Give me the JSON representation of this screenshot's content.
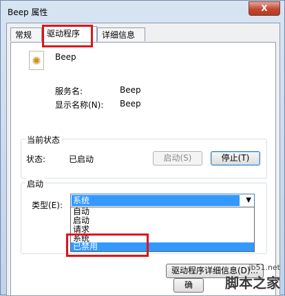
{
  "window": {
    "title": "Beep 属性",
    "close_label": "X"
  },
  "tabs": [
    {
      "label": "常规"
    },
    {
      "label": "驱动程序"
    },
    {
      "label": "详细信息"
    }
  ],
  "driver": {
    "name": "Beep",
    "service_name_label": "服务名:",
    "service_name_value": "Beep",
    "display_name_label": "显示名称(N):",
    "display_name_value": "Beep"
  },
  "current_status": {
    "legend": "当前状态",
    "status_label": "状态:",
    "status_value": "已启动",
    "start_button": "启动(S)",
    "stop_button": "停止(T)"
  },
  "startup": {
    "legend": "启动",
    "type_label": "类型(E):",
    "selected": "系统",
    "options": [
      "自动",
      "启动",
      "请求",
      "系统",
      "已禁用"
    ],
    "highlighted_option": "已禁用"
  },
  "buttons": {
    "driver_details": "驱动程序详细信息(D)...",
    "ok": "确"
  },
  "watermark": {
    "site": "jb51.net",
    "name": "脚本之家"
  },
  "colors": {
    "annotation": "#e0121a",
    "selection": "#3399ff"
  }
}
